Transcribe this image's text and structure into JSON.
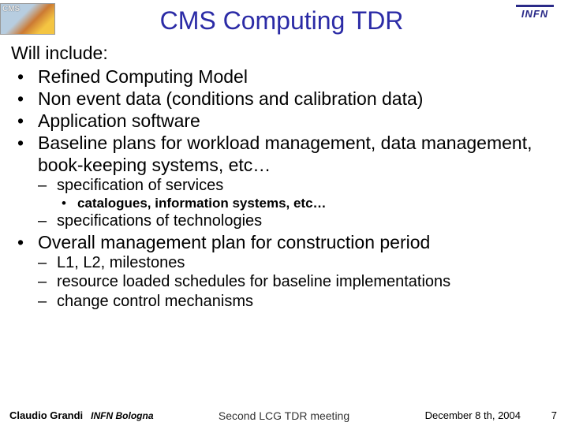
{
  "header": {
    "title": "CMS Computing TDR",
    "left_logo_label": "CMS",
    "right_logo_label": "INFN"
  },
  "body": {
    "lead": "Will include:",
    "bullets_top": [
      "Refined Computing Model",
      "Non event data (conditions and calibration data)",
      "Application software",
      "Baseline plans for workload management, data management, book-keeping systems, etc…"
    ],
    "sub_after_top": [
      "specification of services"
    ],
    "subsub_after_spec": [
      "catalogues, information systems, etc…"
    ],
    "sub_after_subsub": [
      "specifications of technologies"
    ],
    "bullets_mid": [
      "Overall management plan for construction period"
    ],
    "sub_after_mid": [
      "L1, L2, milestones",
      "resource loaded schedules for baseline implementations",
      "change control mechanisms"
    ]
  },
  "footer": {
    "author": "Claudio Grandi",
    "affiliation": "INFN Bologna",
    "venue": "Second LCG TDR meeting",
    "date": "December 8 th, 2004",
    "page": "7"
  }
}
